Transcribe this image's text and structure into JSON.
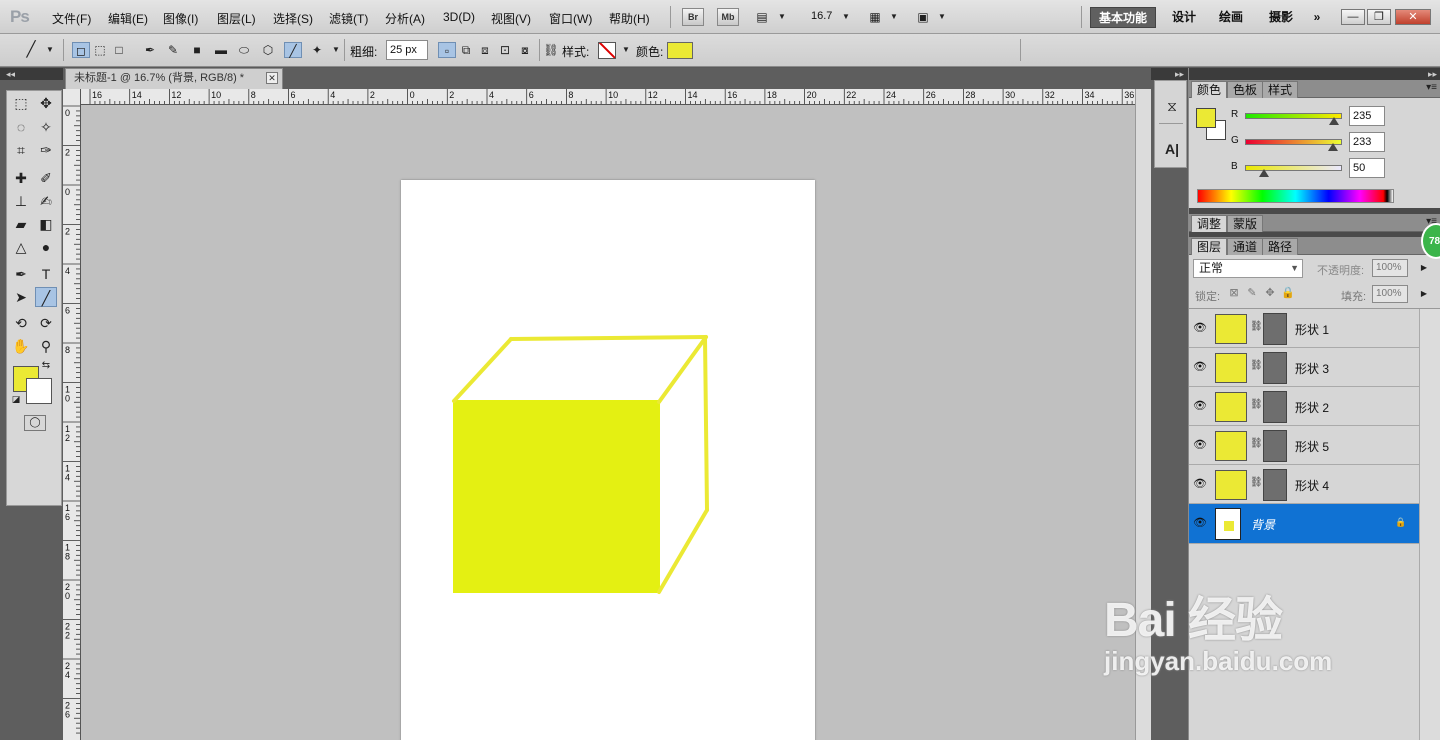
{
  "menubar": {
    "logo": "Ps",
    "items": [
      "文件(F)",
      "编辑(E)",
      "图像(I)",
      "图层(L)",
      "选择(S)",
      "滤镜(T)",
      "分析(A)",
      "3D(D)",
      "视图(V)",
      "窗口(W)",
      "帮助(H)"
    ],
    "bridge_label": "Br",
    "minibridge_label": "Mb",
    "zoom_value": "16.7",
    "workspaces": [
      "基本功能",
      "设计",
      "绘画",
      "摄影"
    ],
    "more_label": "»"
  },
  "options": {
    "weight_label": "粗细:",
    "weight_value": "25 px",
    "style_label": "样式:",
    "color_label": "颜色:",
    "color": "#ebe934"
  },
  "document": {
    "tab_title": "未标题-1 @ 16.7% (背景, RGB/8) *",
    "close_glyph": "✕",
    "ruler_h_labels": [
      "16",
      "14",
      "12",
      "10",
      "8",
      "6",
      "4",
      "2",
      "0",
      "2",
      "4",
      "6",
      "8",
      "10",
      "12",
      "14",
      "16",
      "18",
      "20",
      "22",
      "24",
      "26",
      "28",
      "30",
      "32",
      "34",
      "36"
    ],
    "ruler_v_labels": [
      "0",
      "2",
      "0",
      "2",
      "4",
      "6",
      "8",
      "1 0",
      "1 2",
      "1 4",
      "1 6",
      "1 8",
      "2 0",
      "2 2",
      "2 4",
      "2 6"
    ],
    "shape_color": "#e4f012",
    "stroke_color": "#ebe934"
  },
  "tools": {
    "foreground": "#ebe934",
    "background": "#ffffff"
  },
  "color_panel": {
    "tabs": [
      "颜色",
      "色板",
      "样式"
    ],
    "r_label": "R",
    "r_value": "235",
    "g_label": "G",
    "g_value": "233",
    "b_label": "B",
    "b_value": "50",
    "r_level": 0.92,
    "g_level": 0.91,
    "b_level": 0.2
  },
  "adjust_panel": {
    "tabs": [
      "调整",
      "蒙版"
    ]
  },
  "layers_panel": {
    "tabs": [
      "图层",
      "通道",
      "路径"
    ],
    "blend_mode": "正常",
    "opacity_label": "不透明度:",
    "opacity_value": "100%",
    "lock_label": "锁定:",
    "fill_label": "填充:",
    "fill_value": "100%",
    "layers": [
      {
        "name": "形状 1"
      },
      {
        "name": "形状 3"
      },
      {
        "name": "形状 2"
      },
      {
        "name": "形状 5"
      },
      {
        "name": "形状 4"
      },
      {
        "name": "背景"
      }
    ]
  },
  "badge": "78",
  "watermark": {
    "main": "Bai 经验",
    "sub": "jingyan.baidu.com"
  }
}
